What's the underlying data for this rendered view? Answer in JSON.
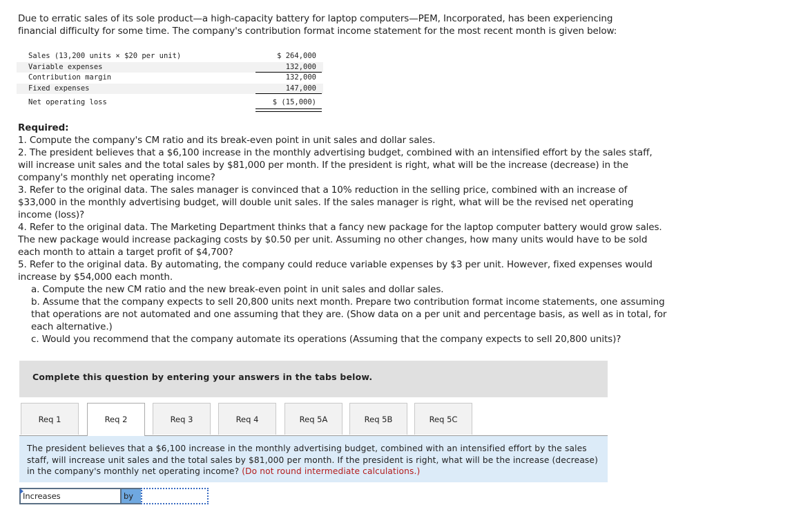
{
  "intro": "Due to erratic sales of its sole product—a high-capacity battery for laptop computers—PEM, Incorporated, has been experiencing financial difficulty for some time. The company's contribution format income statement for the most recent month is given below:",
  "statement": {
    "rows": [
      {
        "label": "Sales (13,200 units × $20 per unit)",
        "amount": "$ 264,000"
      },
      {
        "label": "Variable expenses",
        "amount": "132,000"
      },
      {
        "label": "Contribution margin",
        "amount": "132,000"
      },
      {
        "label": "Fixed expenses",
        "amount": "147,000"
      },
      {
        "label": "Net operating loss",
        "amount": "$ (15,000)"
      }
    ]
  },
  "required": {
    "title": "Required:",
    "items": [
      "1. Compute the company's CM ratio and its break-even point in unit sales and dollar sales.",
      "2. The president believes that a $6,100 increase in the monthly advertising budget, combined with an intensified effort by the sales staff, will increase unit sales and the total sales by $81,000 per month. If the president is right, what will be the increase (decrease) in the company's monthly net operating income?",
      "3. Refer to the original data. The sales manager is convinced that a 10% reduction in the selling price, combined with an increase of $33,000 in the monthly advertising budget, will double unit sales. If the sales manager is right, what will be the revised net operating income (loss)?",
      "4. Refer to the original data. The Marketing Department thinks that a fancy new package for the laptop computer battery would grow sales. The new package would increase packaging costs by $0.50 per unit. Assuming no other changes, how many units would have to be sold each month to attain a target profit of $4,700?",
      "5. Refer to the original data. By automating, the company could reduce variable expenses by $3 per unit. However, fixed expenses would increase by $54,000 each month."
    ],
    "subitems": [
      "a. Compute the new CM ratio and the new break-even point in unit sales and dollar sales.",
      "b. Assume that the company expects to sell 20,800 units next month. Prepare two contribution format income statements, one assuming that operations are not automated and one assuming that they are. (Show data on a per unit and percentage basis, as well as in total, for each alternative.)",
      "c. Would you recommend that the company automate its operations (Assuming that the company expects to sell 20,800 units)?"
    ]
  },
  "banner": "Complete this question by entering your answers in the tabs below.",
  "tabs": [
    {
      "label": "Req 1",
      "active": false
    },
    {
      "label": "Req 2",
      "active": true
    },
    {
      "label": "Req 3",
      "active": false
    },
    {
      "label": "Req 4",
      "active": false
    },
    {
      "label": "Req 5A",
      "active": false
    },
    {
      "label": "Req 5B",
      "active": false
    },
    {
      "label": "Req 5C",
      "active": false
    }
  ],
  "panel": {
    "question": "The president believes that a $6,100 increase in the monthly advertising budget, combined with an intensified effort by the sales staff, will increase unit sales and the total sales by $81,000 per month. If the president is right, what will be the increase (decrease) in the company's monthly net operating income?",
    "note": "(Do not round intermediate calculations.)"
  },
  "answer": {
    "direction_value": "Increases",
    "by_label": "by",
    "amount_value": ""
  }
}
